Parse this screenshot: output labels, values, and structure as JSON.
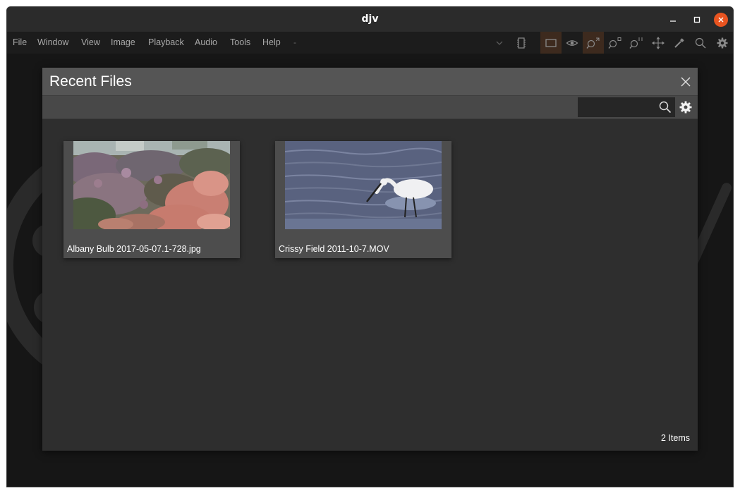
{
  "window": {
    "title": "djv"
  },
  "menubar": {
    "items": [
      "File",
      "Window",
      "View",
      "Image",
      "Playback",
      "Audio",
      "Tools",
      "Help"
    ],
    "current_item": "-"
  },
  "toolbar": {
    "icons": [
      "memory-icon",
      "frame-icon",
      "eye-icon",
      "zoom-fit-icon",
      "zoom-in-icon",
      "zoom-reset-icon",
      "pan-icon",
      "color-picker-icon",
      "magnifier-icon",
      "settings-gear-icon"
    ],
    "accent_color": "#3d2a1e"
  },
  "dialog": {
    "title": "Recent Files",
    "search_value": "",
    "files": [
      {
        "name": "Albany Bulb 2017-05-07.1-728.jpg",
        "thumbnail": "flowers"
      },
      {
        "name": "Crissy Field 2011-10-7.MOV",
        "thumbnail": "egret-in-water"
      }
    ],
    "status": "2 Items"
  },
  "colors": {
    "close_button": "#e95420",
    "title_bar": "#2b2b2b",
    "dialog_bg": "#2e2e2e",
    "dialog_header": "#555555"
  }
}
